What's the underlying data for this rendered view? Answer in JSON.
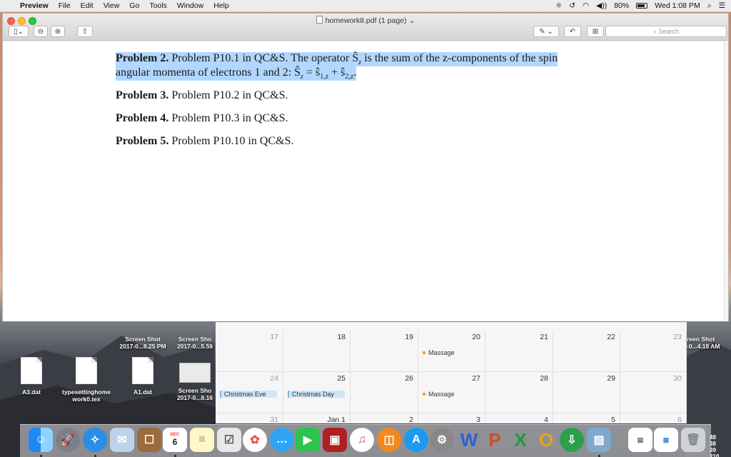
{
  "menubar": {
    "app_name": "Preview",
    "menus": [
      "File",
      "Edit",
      "View",
      "Go",
      "Tools",
      "Window",
      "Help"
    ],
    "battery": "80%",
    "clock": "Wed 1:08 PM"
  },
  "window": {
    "title": "homework8.pdf (1 page)",
    "search_placeholder": "Search"
  },
  "document": {
    "problem2_label": "Problem 2.",
    "problem2_text_line1": " Problem P10.1 in QC&S. The operator Ŝ",
    "problem2_text_line1b": " is the sum of the z-components of the spin",
    "problem2_sub_z": "z",
    "problem2_text_line2": "angular momenta of electrons 1 and 2: Ŝ",
    "problem2_sub_z2": "z",
    "problem2_text_line2b": " = ŝ",
    "problem2_sub_1z": "1,z",
    "problem2_plus": " + ŝ",
    "problem2_sub_2z": "2,z",
    "problem2_end": ".",
    "problem3_label": "Problem 3.",
    "problem3_text": " Problem P10.2 in QC&S.",
    "problem4_label": "Problem 4.",
    "problem4_text": " Problem P10.3 in QC&S.",
    "problem5_label": "Problem 5.",
    "problem5_text": " Problem P10.10 in QC&S."
  },
  "calendar": {
    "week1": [
      "17",
      "18",
      "19",
      "20",
      "21",
      "22",
      "23"
    ],
    "week2": [
      "24",
      "25",
      "26",
      "27",
      "28",
      "29",
      "30"
    ],
    "week3": [
      "31",
      "Jan 1",
      "2",
      "3",
      "4",
      "5",
      "6"
    ],
    "events": {
      "massage1": "Massage",
      "massage2": "Massage",
      "christmas_eve": "Christmas Eve",
      "christmas_day": "Christmas Day"
    }
  },
  "desktop": {
    "files": [
      {
        "name": "Screen Shot\n2017-0...8.25 PM"
      },
      {
        "name": "Screen Sho\n2017-0...5.59"
      },
      {
        "name": "A3.dat"
      },
      {
        "name": "typesettinghome\nwork0.tex"
      },
      {
        "name": "A1.dat"
      },
      {
        "name": "Screen Sho\n2017-0...8.16"
      },
      {
        "name": "reen Shot\n-0...4.18 AM"
      }
    ]
  },
  "dock": {
    "calendar_month": "DEC",
    "calendar_day": "6",
    "clock_lines": [
      "48",
      "38",
      "39",
      "210"
    ]
  }
}
